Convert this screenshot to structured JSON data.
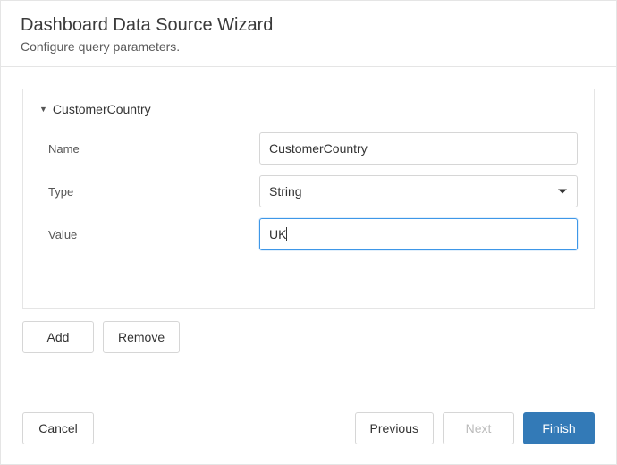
{
  "header": {
    "title": "Dashboard Data Source Wizard",
    "subtitle": "Configure query parameters."
  },
  "parameter": {
    "display_name": "CustomerCountry",
    "fields": {
      "name_label": "Name",
      "name_value": "CustomerCountry",
      "type_label": "Type",
      "type_value": "String",
      "value_label": "Value",
      "value_value": "UK"
    }
  },
  "buttons": {
    "add": "Add",
    "remove": "Remove",
    "cancel": "Cancel",
    "previous": "Previous",
    "next": "Next",
    "finish": "Finish"
  }
}
